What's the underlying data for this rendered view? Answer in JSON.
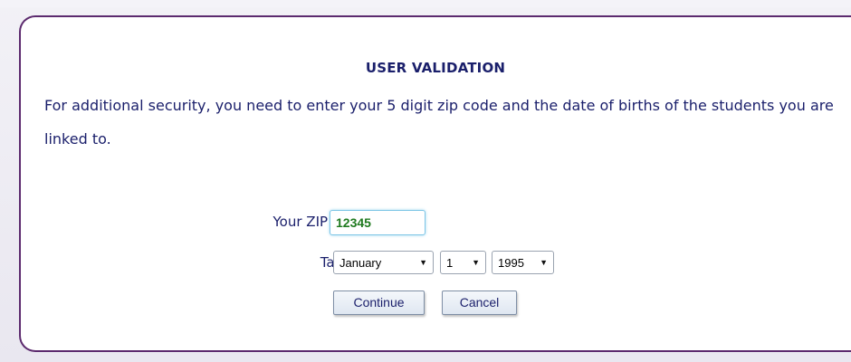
{
  "panel": {
    "title": "USER VALIDATION",
    "instructions": "For additional security, you need to enter your 5 digit zip code and the date of births of the students you are linked to."
  },
  "form": {
    "zip_label": "Your ZIP code",
    "zip_value": "12345",
    "student_label": "Tanner",
    "month_value": "January",
    "day_value": "1",
    "year_value": "1995",
    "arrow_glyph": "▼"
  },
  "buttons": {
    "continue_label": "Continue",
    "cancel_label": "Cancel"
  },
  "colors": {
    "panel_border": "#5c2a6e",
    "text": "#1a1f6b",
    "zip_text": "#1f7a1f",
    "input_focus_border": "#7ec6e6"
  }
}
